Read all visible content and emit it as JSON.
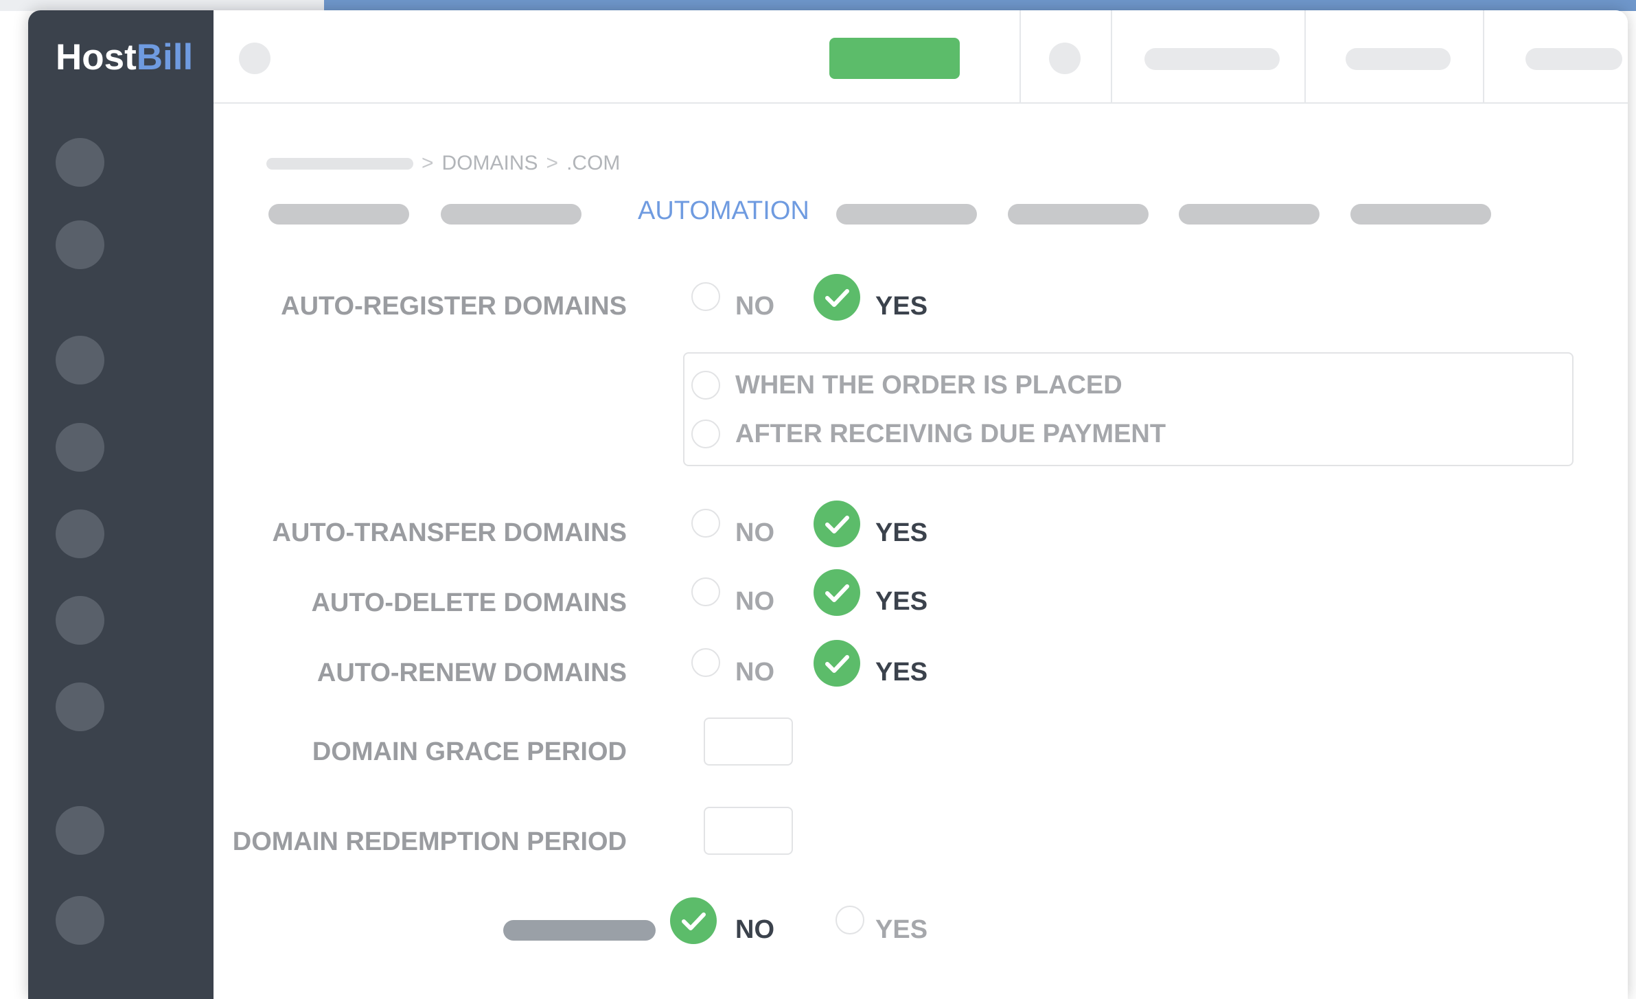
{
  "app": {
    "logo_part1": "Host",
    "logo_part2": "Bill"
  },
  "breadcrumb": {
    "items": [
      "DOMAINS",
      ".COM"
    ],
    "separator": ">"
  },
  "tabs": {
    "active_label": "AUTOMATION"
  },
  "settings": {
    "auto_register": {
      "label": "AUTO-REGISTER DOMAINS",
      "no": "NO",
      "yes": "YES",
      "selected": "yes"
    },
    "register_when": {
      "options": [
        "WHEN THE ORDER IS PLACED",
        "AFTER RECEIVING DUE PAYMENT"
      ]
    },
    "auto_transfer": {
      "label": "AUTO-TRANSFER DOMAINS",
      "no": "NO",
      "yes": "YES",
      "selected": "yes"
    },
    "auto_delete": {
      "label": "AUTO-DELETE DOMAINS",
      "no": "NO",
      "yes": "YES",
      "selected": "yes"
    },
    "auto_renew": {
      "label": "AUTO-RENEW DOMAINS",
      "no": "NO",
      "yes": "YES",
      "selected": "yes"
    },
    "grace_period": {
      "label": "DOMAIN GRACE PERIOD",
      "value": ""
    },
    "redemption_period": {
      "label": "DOMAIN REDEMPTION PERIOD",
      "value": ""
    },
    "last_option": {
      "no": "NO",
      "yes": "YES",
      "selected": "no"
    }
  },
  "colors": {
    "sidebar": "#3b424c",
    "accent_blue": "#6f9be0",
    "green": "#5cbc6a"
  },
  "icons": [
    "check-icon",
    "chevron-right-icon"
  ]
}
